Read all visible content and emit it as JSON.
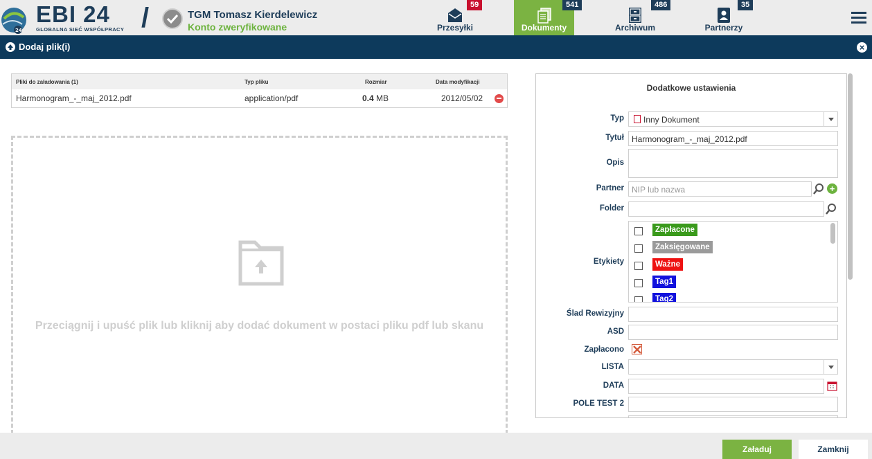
{
  "header": {
    "logo_text": "EBI 24",
    "logo_subtitle": "GLOBALNA SIEĆ WSPÓŁPRACY",
    "logo_icon": "globe-24-icon",
    "separator": "/",
    "company_name": "TGM Tomasz Kierdelewicz",
    "verified_text": "Konto zweryfikowane",
    "verified_icon": "check-circle-icon"
  },
  "nav": [
    {
      "label": "Przesyłki",
      "badge": "59",
      "icon": "envelope-icon",
      "active": false
    },
    {
      "label": "Dokumenty",
      "badge": "541",
      "icon": "documents-icon",
      "active": true
    },
    {
      "label": "Archiwum",
      "badge": "486",
      "icon": "archive-cabinet-icon",
      "active": false
    },
    {
      "label": "Partnerzy",
      "badge": "35",
      "icon": "contact-book-icon",
      "active": false
    }
  ],
  "dialog": {
    "title": "Dodaj plik(i)",
    "close_symbol": "×"
  },
  "file_table": {
    "headers": {
      "name": "Pliki do załadowania (1)",
      "type": "Typ pliku",
      "size": "Rozmiar",
      "date": "Data modyfikacji"
    },
    "rows": [
      {
        "name": "Harmonogram_-_maj_2012.pdf",
        "type": "application/pdf",
        "size_value": "0.4",
        "size_unit": "MB",
        "date": "2012/05/02"
      }
    ]
  },
  "dropzone": {
    "text": "Przeciągnij i upuść plik lub kliknij aby dodać dokument w postaci pliku pdf lub skanu",
    "icon": "folder-upload-icon"
  },
  "settings": {
    "title": "Dodatkowe ustawienia",
    "typ": {
      "label": "Typ",
      "value": "Inny Dokument"
    },
    "tytul": {
      "label": "Tytuł",
      "value": "Harmonogram_-_maj_2012.pdf"
    },
    "opis": {
      "label": "Opis",
      "value": ""
    },
    "partner": {
      "label": "Partner",
      "placeholder": "NIP lub nazwa"
    },
    "folder": {
      "label": "Folder",
      "value": ""
    },
    "etykiety": {
      "label": "Etykiety",
      "tags": [
        {
          "name": "Zapłacone",
          "color": "#3a9a1c",
          "checked": false
        },
        {
          "name": "Zaksięgowane",
          "color": "#9a9a9a",
          "checked": false
        },
        {
          "name": "Ważne",
          "color": "#ee1111",
          "checked": false
        },
        {
          "name": "Tag1",
          "color": "#1111dd",
          "checked": false
        },
        {
          "name": "Tag2",
          "color": "#1111dd",
          "checked": false
        }
      ]
    },
    "slad": {
      "label": "Ślad Rewizyjny",
      "value": ""
    },
    "asd": {
      "label": "ASD",
      "value": ""
    },
    "zaplacono": {
      "label": "Zapłacono",
      "checked": true
    },
    "lista": {
      "label": "LISTA",
      "value": ""
    },
    "data": {
      "label": "DATA",
      "value": ""
    },
    "pole_test": {
      "label": "POLE TEST 2",
      "value": ""
    }
  },
  "footer": {
    "upload_label": "Załaduj",
    "close_label": "Zamknij"
  },
  "colors": {
    "navy": "#1e3d59",
    "titlebar": "#0d3a5c",
    "green": "#7bb342",
    "badge_red": "#c8102e"
  }
}
